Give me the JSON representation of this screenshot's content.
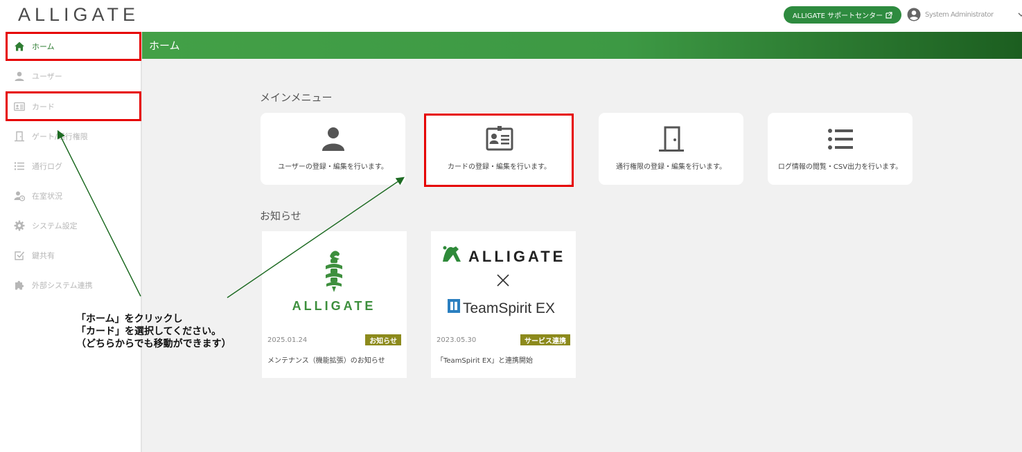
{
  "header": {
    "logo": "ALLIGATE",
    "support_label": "ALLIGATE サポートセンター",
    "user_name": "System Administrator"
  },
  "sidebar": {
    "items": [
      {
        "label": "ホーム",
        "icon": "home-icon",
        "active": true
      },
      {
        "label": "ユーザー",
        "icon": "user-icon"
      },
      {
        "label": "カード",
        "icon": "id-card-icon"
      },
      {
        "label": "ゲート/通行権限",
        "icon": "door-icon"
      },
      {
        "label": "通行ログ",
        "icon": "list-icon"
      },
      {
        "label": "在室状況",
        "icon": "user-clock-icon"
      },
      {
        "label": "システム設定",
        "icon": "gear-icon"
      },
      {
        "label": "鍵共有",
        "icon": "checkbox-icon"
      },
      {
        "label": "外部システム連携",
        "icon": "puzzle-icon"
      }
    ]
  },
  "main": {
    "page_title": "ホーム",
    "menu_title": "メインメニュー",
    "menu_cards": [
      {
        "label": "ユーザーの登録・編集を行います。",
        "icon": "user-icon"
      },
      {
        "label": "カードの登録・編集を行います。",
        "icon": "id-card-icon"
      },
      {
        "label": "通行権限の登録・編集を行います。",
        "icon": "door-icon"
      },
      {
        "label": "ログ情報の閲覧・CSV出力を行います。",
        "icon": "list-icon"
      }
    ],
    "news_title": "お知らせ",
    "news": [
      {
        "logo_text": "ALLIGATE",
        "date": "2025.01.24",
        "badge": "お知らせ",
        "title": "メンテナンス（機能拡張）のお知らせ"
      },
      {
        "logo_text": "ALLIGATE",
        "partner_text": "TeamSpirit EX",
        "date": "2023.05.30",
        "badge": "サービス連携",
        "title": "「TeamSpirit EX」と連携開始"
      }
    ]
  },
  "annotation": "「ホーム」をクリックし\n「カード」を選択してください。\n（どちらからでも移動ができます）",
  "colors": {
    "brand_green": "#43a047",
    "highlight_red": "#e60000",
    "badge_olive": "#8c8a1c"
  }
}
